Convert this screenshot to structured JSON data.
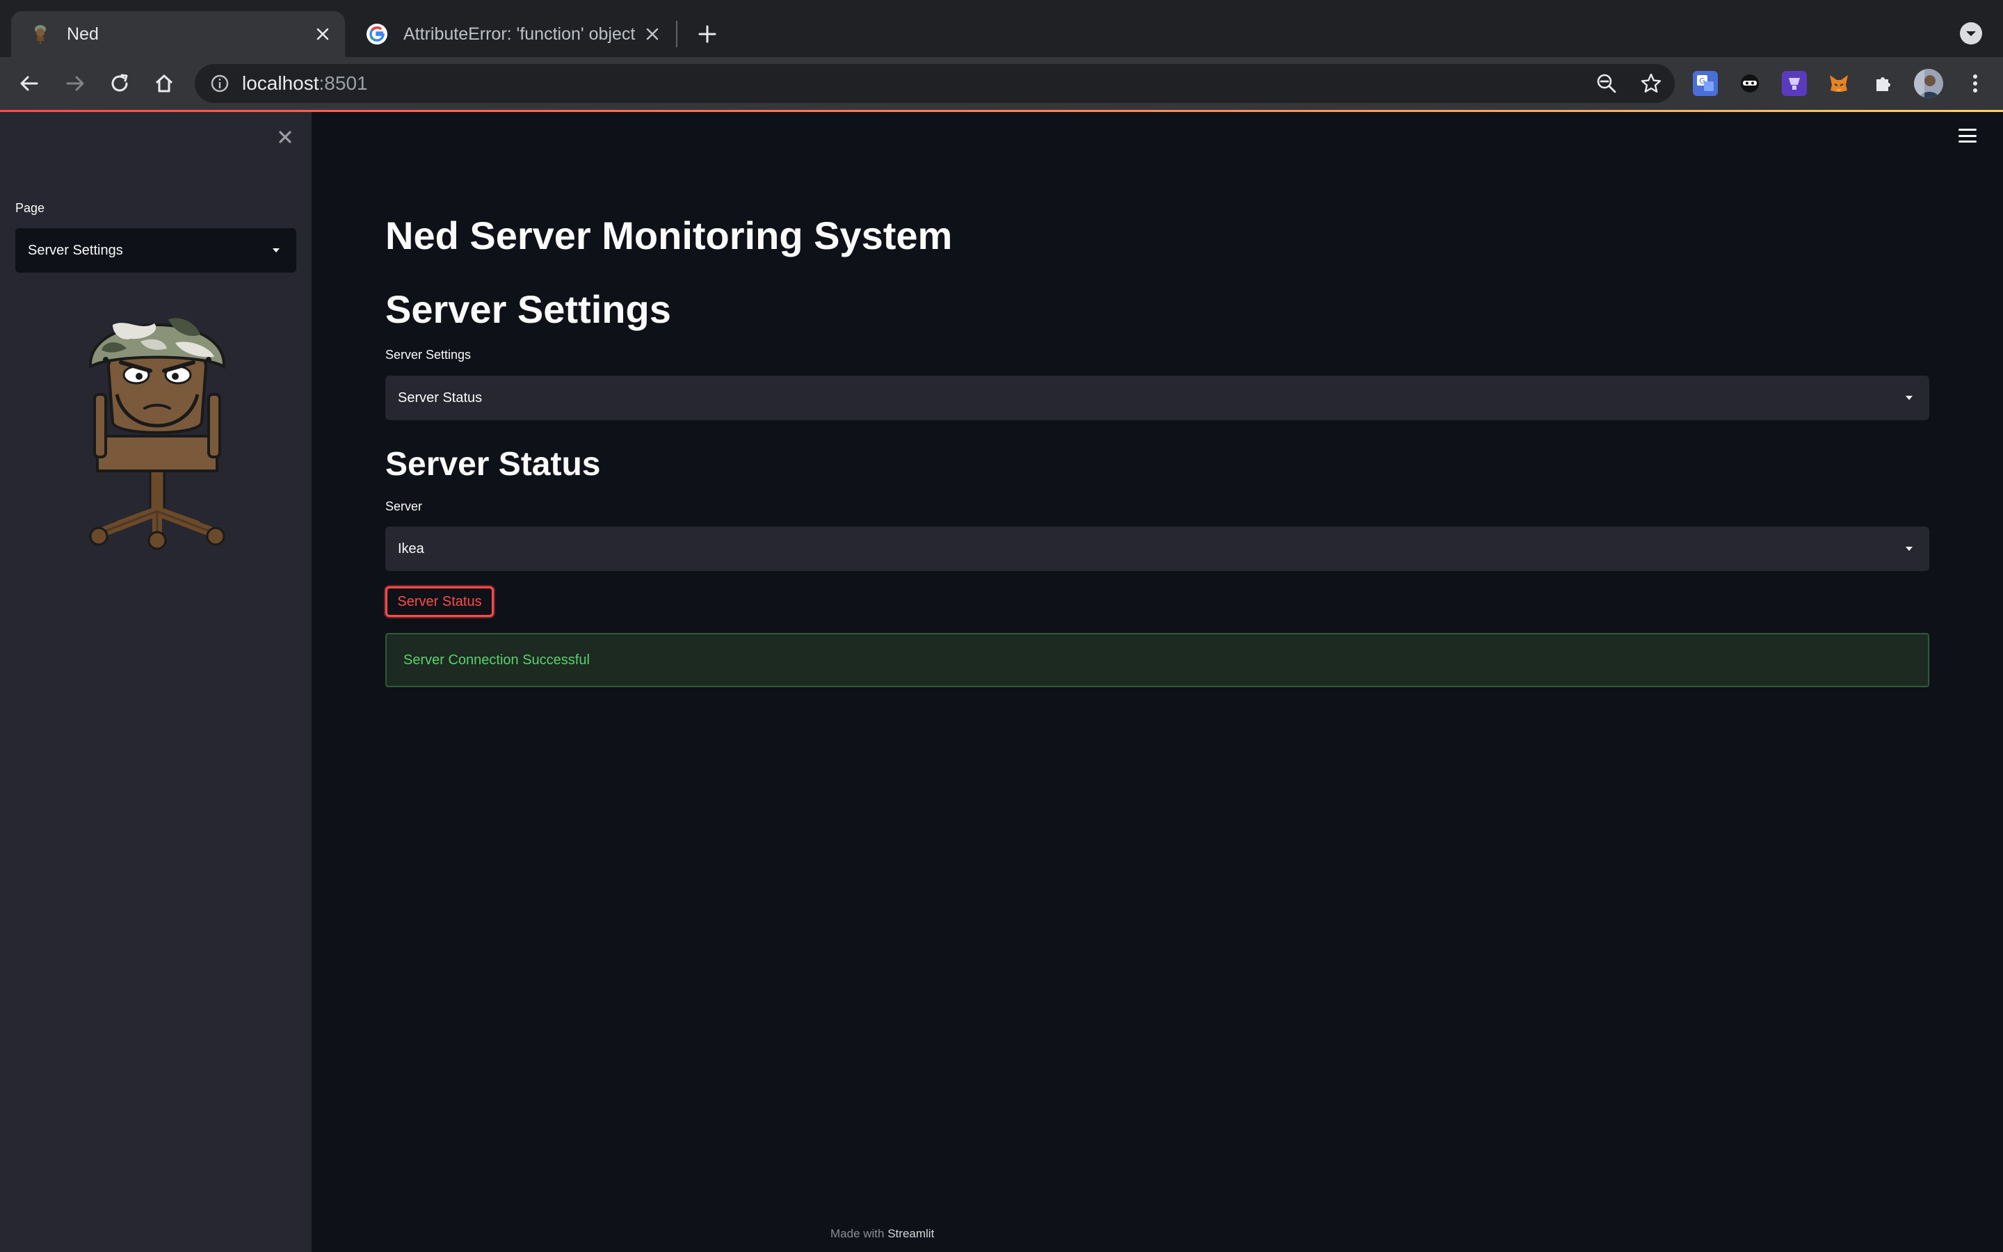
{
  "browser": {
    "tabs": [
      {
        "title": "Ned",
        "active": true
      },
      {
        "title": "AttributeError: 'function' object",
        "active": false
      }
    ],
    "url_host": "localhost",
    "url_port": ":8501",
    "extensions": [
      "translate-extension-icon",
      "ninja-extension-icon",
      "purple-extension-icon",
      "fox-wallet-extension-icon",
      "puzzle-icon",
      "profile-avatar"
    ]
  },
  "sidebar": {
    "page_label": "Page",
    "page_value": "Server Settings"
  },
  "main": {
    "title": "Ned Server Monitoring System",
    "section_title": "Server Settings",
    "settings_label": "Server Settings",
    "settings_value": "Server Status",
    "subsection_title": "Server Status",
    "server_label": "Server",
    "server_value": "Ikea",
    "status_button": "Server Status",
    "alert_text": "Server Connection Successful"
  },
  "footer": {
    "prefix": "Made with",
    "brand": "Streamlit"
  },
  "colors": {
    "accent": "#ff4b4b",
    "success_text": "#5ad16a",
    "success_bg": "#1c2a22",
    "background": "#0e1117",
    "sidebar": "#262730"
  }
}
